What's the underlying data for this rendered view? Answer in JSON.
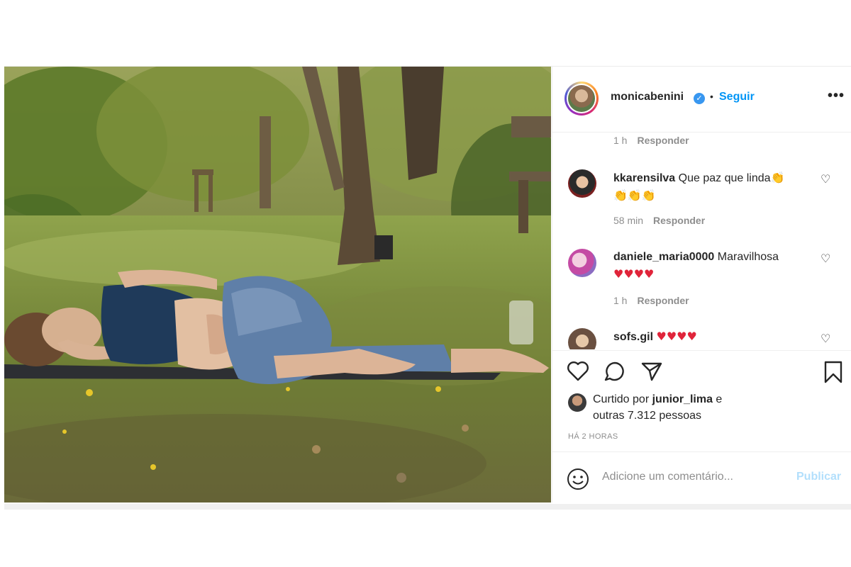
{
  "post": {
    "username": "monicabenini",
    "verified_icon": "verified-badge-icon",
    "separator": "•",
    "follow_label": "Seguir",
    "more_label": "•••"
  },
  "comments": [
    {
      "user": "",
      "text": "",
      "time": "1 h",
      "reply_label": "Responder"
    },
    {
      "user": "kkarensilva",
      "text": "Que paz que linda",
      "emoji": "👏",
      "emoji_line": "👏👏👏",
      "time": "58 min",
      "reply_label": "Responder"
    },
    {
      "user": "daniele_maria0000",
      "text": "Maravilhosa",
      "emoji_line": "♥♥♥♥",
      "time": "1 h",
      "reply_label": "Responder"
    },
    {
      "user": "sofs.gil",
      "emoji_line": "♥♥♥♥"
    }
  ],
  "actions": {
    "like_icon": "heart-icon",
    "comment_icon": "comment-icon",
    "share_icon": "share-icon",
    "save_icon": "bookmark-icon",
    "liked_by_prefix": "Curtido por",
    "liked_by_user": "junior_lima",
    "liked_by_suffix": "e",
    "others_text": "outras 7.312 pessoas",
    "timestamp": "HÁ 2 HORAS"
  },
  "add_comment": {
    "placeholder": "Adicione um comentário...",
    "publish_label": "Publicar"
  },
  "colors": {
    "accent": "#0095f6",
    "publish_disabled": "#b2dffc",
    "heart_red": "#e0243a"
  }
}
